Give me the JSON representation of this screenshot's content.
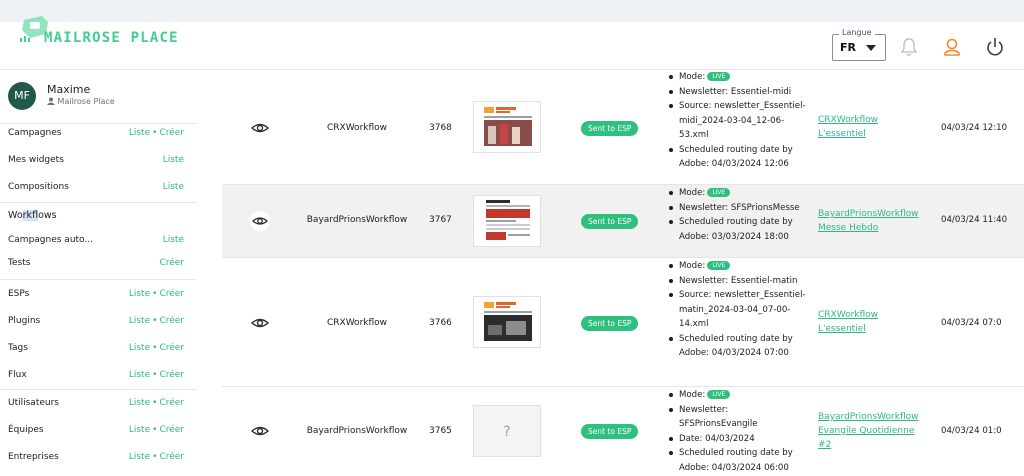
{
  "header": {
    "logo_text": "MAILROSE PLACE",
    "language_label": "Langue",
    "language_value": "FR",
    "colors": {
      "brand": "#3fcf8e",
      "accent": "#f28c28"
    }
  },
  "user": {
    "initials": "MF",
    "name": "Maxime",
    "org": "Mailrose Place"
  },
  "sidebar": {
    "items": [
      {
        "label": "Campagnes",
        "liste": "Liste",
        "creer": "Créer"
      },
      {
        "label": "Mes widgets",
        "liste": "Liste",
        "creer": ""
      },
      {
        "label": "Compositions",
        "liste": "Liste",
        "creer": ""
      },
      {
        "label": "Workflows",
        "liste": "",
        "creer": ""
      },
      {
        "label": "Campagnes auto...",
        "liste": "Liste",
        "creer": ""
      },
      {
        "label": "Tests",
        "liste": "",
        "creer": "Créer"
      },
      {
        "label": "ESPs",
        "liste": "Liste",
        "creer": "Créer"
      },
      {
        "label": "Plugins",
        "liste": "Liste",
        "creer": "Créer"
      },
      {
        "label": "Tags",
        "liste": "Liste",
        "creer": "Créer"
      },
      {
        "label": "Flux",
        "liste": "Liste",
        "creer": "Créer"
      },
      {
        "label": "Utilisateurs",
        "liste": "Liste",
        "creer": "Créer"
      },
      {
        "label": "Équipes",
        "liste": "Liste",
        "creer": "Créer"
      },
      {
        "label": "Entreprises",
        "liste": "Liste",
        "creer": "Créer"
      }
    ],
    "dot": "•"
  },
  "rows": [
    {
      "workflow": "CRXWorkflow",
      "id": "3768",
      "status": "Sent to ESP",
      "details": [
        "Mode:",
        "Newsletter: Essentiel-midi",
        "Source: newsletter_Essentiel-midi_2024-03-04_12-06-53.xml",
        "Scheduled routing date by Adobe: 04/03/2024 12:06"
      ],
      "live": "LIVE",
      "links": [
        "CRXWorkflow",
        "L'essentiel"
      ],
      "date": "04/03/24 12:10"
    },
    {
      "workflow": "BayardPrionsWorkflow",
      "id": "3767",
      "status": "Sent to ESP",
      "details": [
        "Mode:",
        "Newsletter: SFSPrionsMesse",
        "Scheduled routing date by Adobe: 03/03/2024 18:00"
      ],
      "live": "LIVE",
      "links": [
        "BayardPrionsWorkflow",
        "Messe Hebdo"
      ],
      "date": "04/03/24 11:40"
    },
    {
      "workflow": "CRXWorkflow",
      "id": "3766",
      "status": "Sent to ESP",
      "details": [
        "Mode:",
        "Newsletter: Essentiel-matin",
        "Source: newsletter_Essentiel-matin_2024-03-04_07-00-14.xml",
        "Scheduled routing date by Adobe: 04/03/2024 07:00"
      ],
      "live": "LIVE",
      "links": [
        "CRXWorkflow",
        "L'essentiel"
      ],
      "date": "04/03/24 07:0"
    },
    {
      "workflow": "BayardPrionsWorkflow",
      "id": "3765",
      "status": "Sent to ESP",
      "details": [
        "Mode:",
        "Newsletter: SFSPrionsEvangile",
        "Date: 04/03/2024",
        "Scheduled routing date by Adobe: 04/03/2024 06:00"
      ],
      "live": "LIVE",
      "links": [
        "BayardPrionsWorkflow",
        "Evangile Quotidienne #2"
      ],
      "date": "04/03/24 01:0"
    }
  ],
  "placeholder_thumb": "?"
}
